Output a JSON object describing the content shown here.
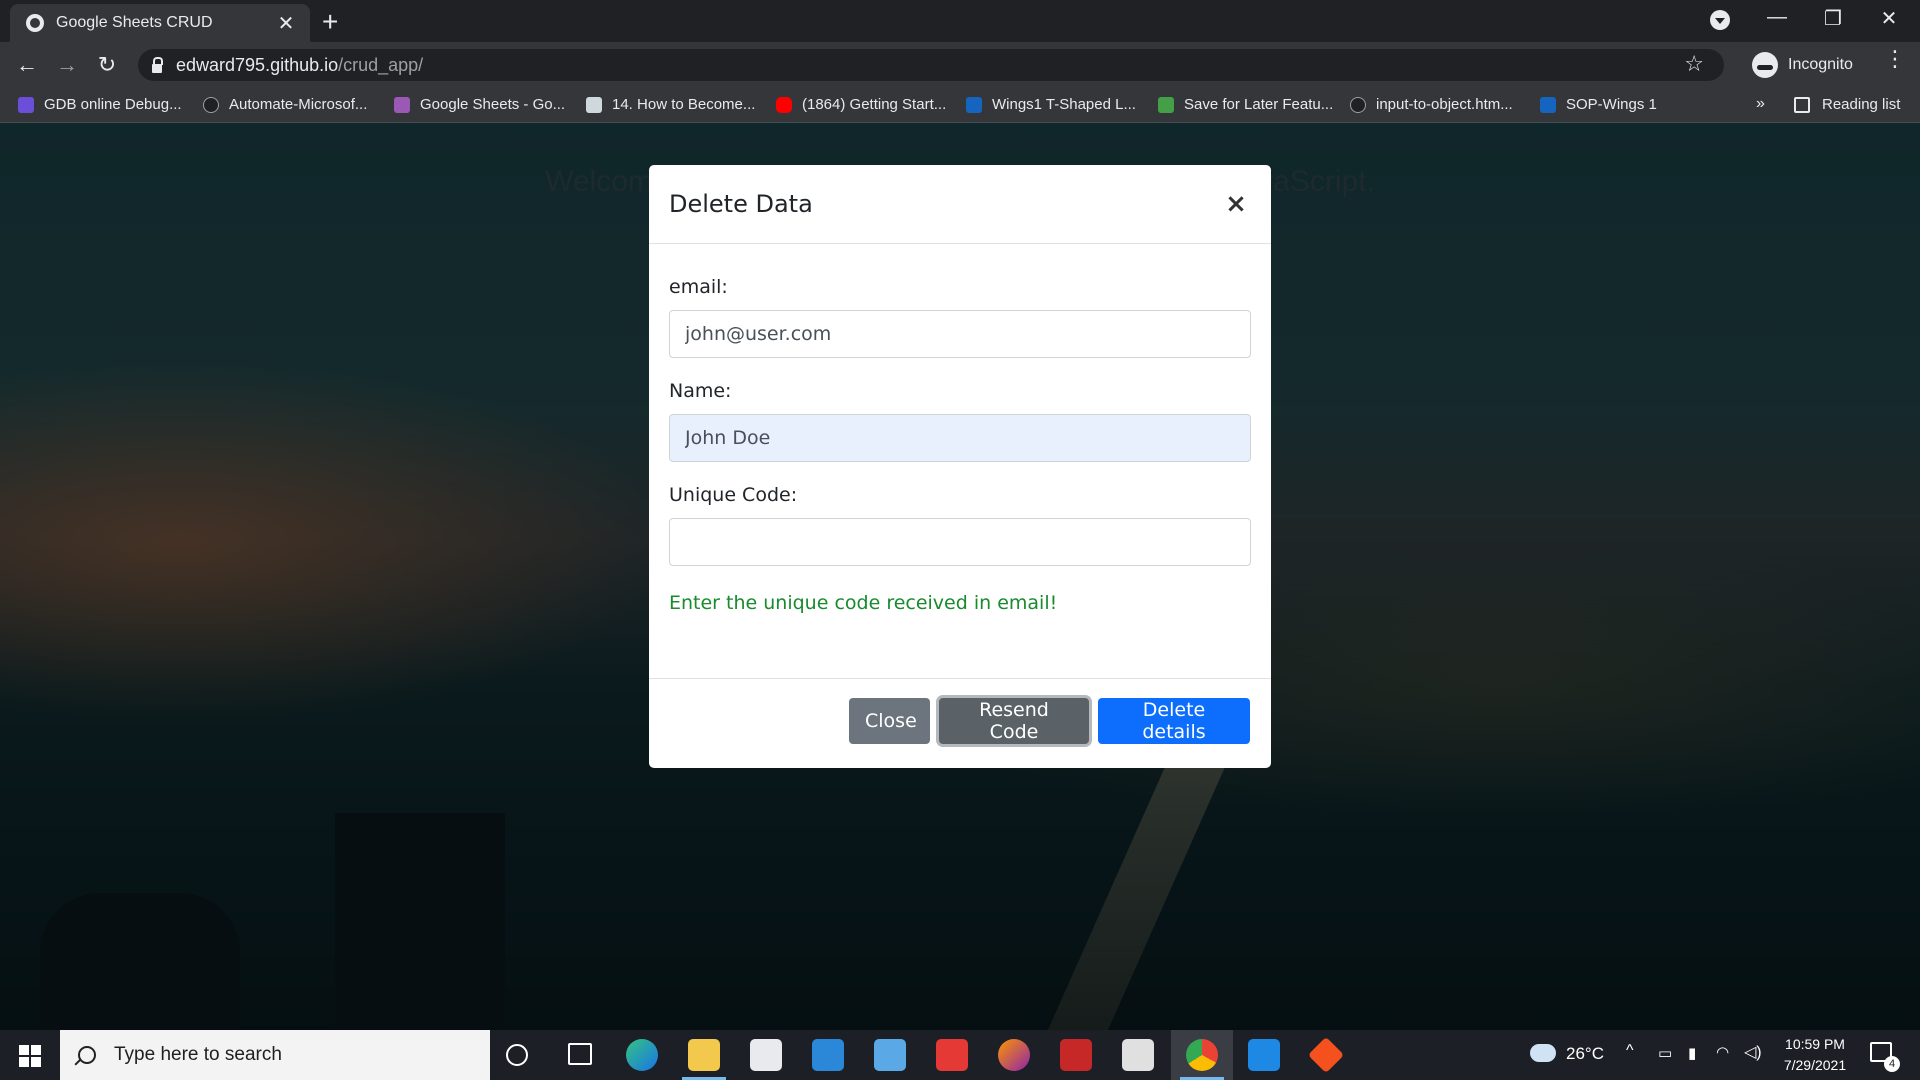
{
  "browser": {
    "tab_title": "Google Sheets CRUD",
    "tab_close": "✕",
    "new_tab": "+",
    "url_host": "edward795.github.io",
    "url_path": "/crud_app/",
    "profile": "Incognito",
    "window_controls": [
      "—",
      "❐",
      "✕"
    ]
  },
  "bookmarks": {
    "items": [
      {
        "label": "GDB online Debug...",
        "color": "#6b4fd8"
      },
      {
        "label": "Automate-Microsof...",
        "color": "#202124"
      },
      {
        "label": "Google Sheets - Go...",
        "color": "#9b59b6"
      },
      {
        "label": "14. How to Become...",
        "color": "#cfd8dc"
      },
      {
        "label": "(1864) Getting Start...",
        "color": "#ff0000"
      },
      {
        "label": "Wings1 T-Shaped L...",
        "color": "#1565c0"
      },
      {
        "label": "Save for Later Featu...",
        "color": "#43a047"
      },
      {
        "label": "input-to-object.htm...",
        "color": "#202124"
      },
      {
        "label": "SOP-Wings 1",
        "color": "#1565c0"
      }
    ],
    "more": "»",
    "reading_list": "Reading list"
  },
  "page": {
    "heading": "Welcome to Google Sheets CRUD application with JavaScript."
  },
  "modal": {
    "title": "Delete Data",
    "close_symbol": "×",
    "email_label": "email:",
    "email_value": "john@user.com",
    "name_label": "Name:",
    "name_value": "John Doe",
    "code_label": "Unique Code:",
    "code_value": "",
    "hint": "Enter the unique code received in email!",
    "buttons": {
      "close": "Close",
      "resend": "Resend Code",
      "delete": "Delete details"
    }
  },
  "taskbar": {
    "search_placeholder": "Type here to search",
    "weather": "26°C",
    "time": "10:59 PM",
    "date": "7/29/2021",
    "notifications": "4",
    "apps": [
      "cortana-icon",
      "task-view-icon",
      "edge-icon",
      "file-explorer-icon",
      "store-icon",
      "mail-icon",
      "control-panel-icon",
      "app-red-icon",
      "firefox-icon",
      "filezilla-icon",
      "notepad-icon",
      "chrome-icon",
      "vscode-icon",
      "git-icon"
    ]
  }
}
